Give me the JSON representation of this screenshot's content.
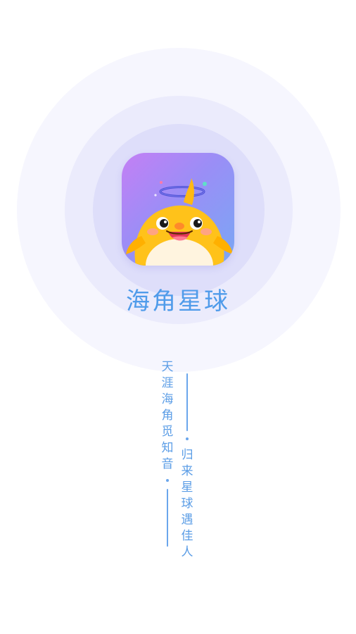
{
  "app": {
    "name": "海角星球"
  },
  "tagline": {
    "left_line": [
      "天",
      "涯",
      "海",
      "角",
      "觅",
      "知",
      "音"
    ],
    "right_line": [
      "归",
      "来",
      "星",
      "球",
      "遇",
      "佳",
      "人"
    ]
  },
  "colors": {
    "background": "#ffffff",
    "halo_outer": "#f6f6fe",
    "halo_middle": "#ebebfc",
    "halo_inner": "#dedefa",
    "text_blue": "#4f9bea",
    "icon_gradient_start": "#c47ff5",
    "icon_gradient_end": "#7aa7f4",
    "mascot_yellow": "#ffc21a"
  },
  "icons": {
    "logo": "duck-mascot-icon"
  }
}
